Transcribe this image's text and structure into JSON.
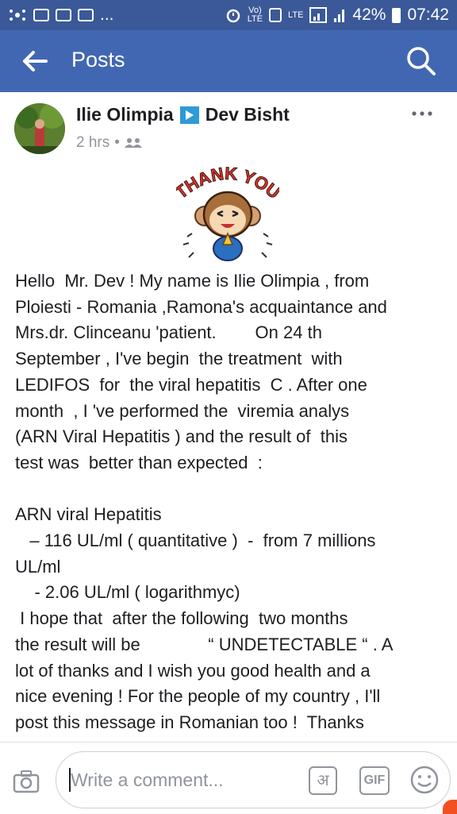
{
  "status_bar": {
    "notif_more": "...",
    "volte_top": "Vo)",
    "volte_bottom": "LTE",
    "lte": "LTE",
    "battery": "42%",
    "time": "07:42"
  },
  "app_bar": {
    "title": "Posts",
    "back_icon": "arrow-left",
    "search_icon": "magnifier"
  },
  "post": {
    "author": "Ilie Olimpia",
    "recipient": "Dev Bisht",
    "time": "2 hrs",
    "separator": "•",
    "audience_icon": "friends",
    "sticker": {
      "banner": "THANK YOU",
      "banner_color": "#e2322b"
    },
    "text": "Hello  Mr. Dev ! My name is Ilie Olimpia , from\nPloiesti - Romania ,Ramona's acquaintance and\nMrs.dr. Clinceanu 'patient.        On 24 th\nSeptember , I've begin  the treatment  with\nLEDIFOS  for  the viral hepatitis  C . After one\nmonth  , I 've performed the  viremia analys\n(ARN Viral Hepatitis ) and the result of  this\ntest was  better than expected  :\n\nARN viral Hepatitis\n   – 116 UL/ml ( quantitative )  -  from 7 millions\nUL/ml\n    - 2.06 UL/ml ( logarithmyc)\n I hope that  after the following  two months\nthe result will be              “ UNDETECTABLE “ . A\nlot of thanks and I wish you good health and a\nnice evening ! For the people of my country , I'll\npost this message in Romanian too !  Thanks"
  },
  "comment_bar": {
    "placeholder": "Write a comment...",
    "hindi_label": "अ",
    "gif_label": "GIF"
  },
  "colors": {
    "status_bar": "#3b5998",
    "app_bar": "#4267b2",
    "text": "#1c1e21",
    "meta": "#90949c"
  }
}
